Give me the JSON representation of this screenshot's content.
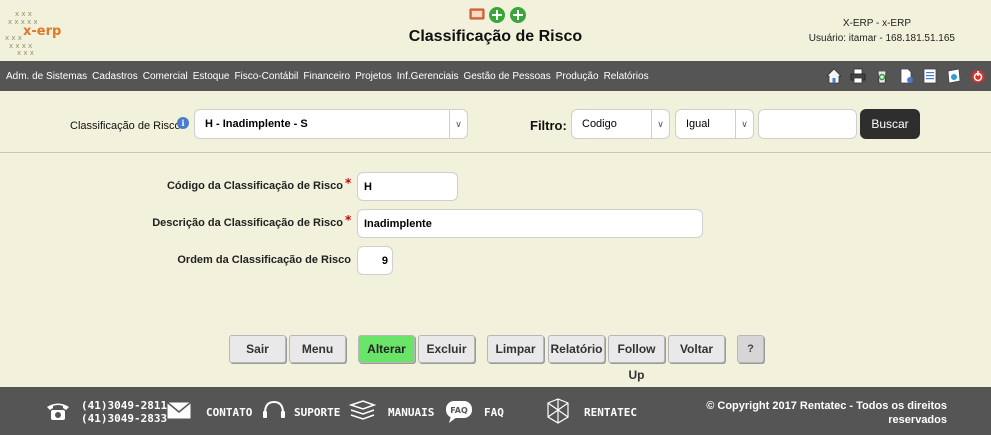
{
  "header": {
    "logo_text": "x-erp",
    "title": "Classificação de Risco",
    "system_name": "X-ERP - x-ERP",
    "user_info": "Usuário: itamar - 168.181.51.165",
    "top_icons": [
      "presentation-icon",
      "add-icon",
      "add-icon"
    ]
  },
  "menu": {
    "items": [
      "Adm. de Sistemas",
      "Cadastros",
      "Comercial",
      "Estoque",
      "Fisco-Contábil",
      "Financeiro",
      "Projetos",
      "Inf.Gerenciais",
      "Gestão de Pessoas",
      "Produção",
      "Relatórios"
    ],
    "icons": [
      "home-icon",
      "printer-icon",
      "recycle-icon",
      "new-document-icon",
      "document-list-icon",
      "search-document-icon",
      "power-icon"
    ]
  },
  "search": {
    "label": "Classificação de Risco",
    "selected": "H - Inadimplente - S",
    "filtro_label": "Filtro:",
    "filtro_field": "Codigo",
    "filtro_operator": "Igual",
    "filtro_value": "",
    "buscar_label": "Buscar"
  },
  "form": {
    "codigo_label": "Código da Classificação de Risco",
    "codigo_value": "H",
    "descricao_label": "Descrição da Classificação de Risco",
    "descricao_value": "Inadimplente",
    "ordem_label": "Ordem da Classificação de Risco",
    "ordem_value": "9",
    "required_mark": "*"
  },
  "actions": {
    "sair": "Sair",
    "menu": "Menu",
    "alterar": "Alterar",
    "excluir": "Excluir",
    "limpar": "Limpar",
    "relatorio": "Relatório",
    "follow_up": "Follow Up",
    "voltar": "Voltar",
    "help": "?"
  },
  "footer": {
    "phone1": "(41)3049-2811",
    "phone2": "(41)3049-2833",
    "contato": "CONTATO",
    "suporte": "SUPORTE",
    "manuais": "MANUAIS",
    "faq": "FAQ",
    "faq_icon_text": "FAQ",
    "rentatec": "RENTATEC",
    "copyright_line1": "© Copyright 2017 Rentatec - Todos os direitos",
    "copyright_line2": "reservados"
  },
  "colors": {
    "background": "#f1f1dc",
    "navbar": "#555555",
    "alterar_green": "#69e469",
    "required_red": "#d00000"
  }
}
